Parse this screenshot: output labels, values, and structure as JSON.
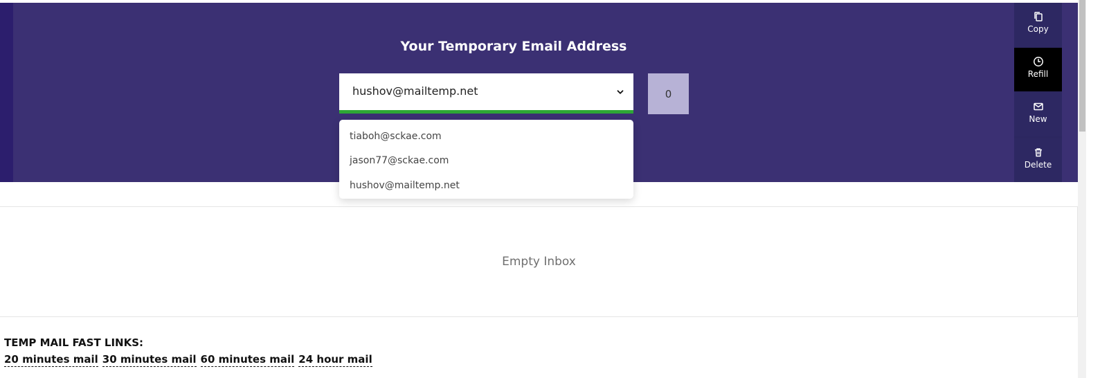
{
  "hero": {
    "title": "Your Temporary Email Address",
    "selected_email": "hushov@mailtemp.net",
    "counter": "0"
  },
  "dropdown": {
    "options": [
      "tiaboh@sckae.com",
      "jason77@sckae.com",
      "hushov@mailtemp.net"
    ]
  },
  "sidebar": {
    "items": [
      {
        "label": "Copy",
        "icon": "copy-icon"
      },
      {
        "label": "Refill",
        "icon": "clock-icon",
        "active": true
      },
      {
        "label": "New",
        "icon": "mail-icon"
      },
      {
        "label": "Delete",
        "icon": "trash-icon"
      }
    ]
  },
  "inbox": {
    "empty_text": "Empty Inbox"
  },
  "fast_links": {
    "heading": "TEMP MAIL FAST LINKS:",
    "links": [
      "20 minutes mail",
      "30 minutes mail",
      "60 minutes mail",
      "24 hour mail"
    ]
  },
  "colors": {
    "hero_bg": "#3b3073",
    "accent_green": "#2ea736",
    "counter_bg": "#b7b2d6"
  }
}
